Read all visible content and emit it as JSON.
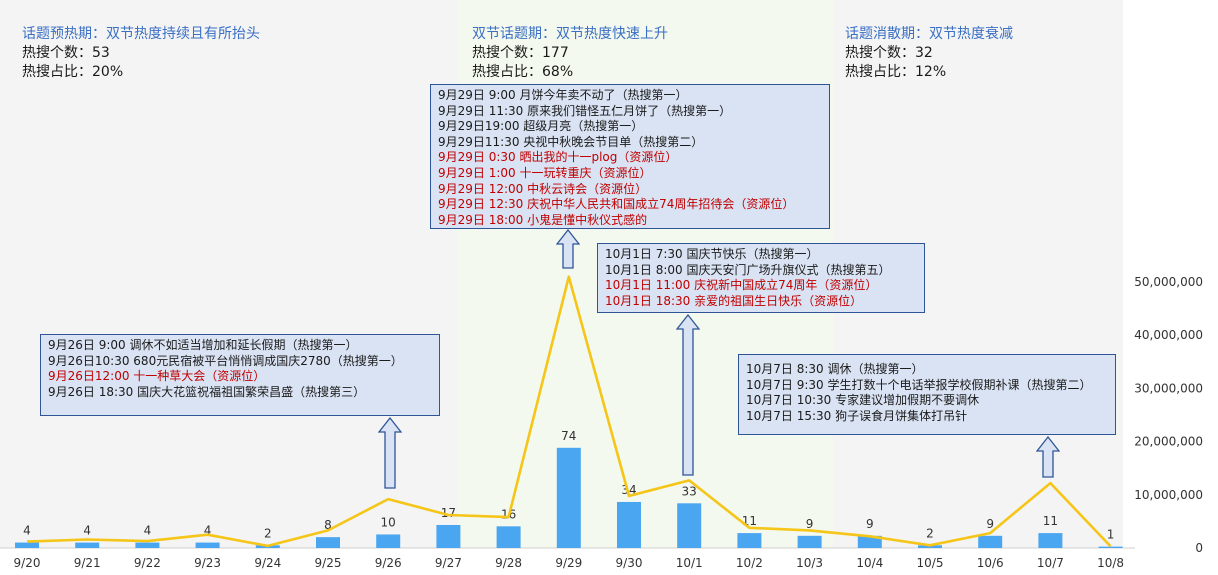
{
  "colors": {
    "bar": "#4aa6f0",
    "line": "#f5c518",
    "phase_pre_bg": "#f4f4f4",
    "phase_peak_bg": "#f3f9ee",
    "phase_post_bg": "#f4f4f4",
    "callout_bg": "#dae3f3",
    "callout_border": "#2f5597",
    "phase_title": "#3a6fc4",
    "red_text": "#c00000"
  },
  "phases": [
    {
      "title": "话题预热期：双节热度持续且有所抬头",
      "count": "热搜个数：53",
      "share": "热搜占比：20%"
    },
    {
      "title": "双节话题期：双节热度快速上升",
      "count": "热搜个数：177",
      "share": "热搜占比：68%"
    },
    {
      "title": "话题消散期：双节热度衰减",
      "count": "热搜个数：32",
      "share": "热搜占比：12%"
    }
  ],
  "callouts": [
    {
      "lines": [
        {
          "text": "9月26日 9:00 调休不如适当增加和延长假期（热搜第一）",
          "red": false
        },
        {
          "text": "9月26日10:30 680元民宿被平台悄悄调成国庆2780（热搜第一）",
          "red": false
        },
        {
          "text": "9月26日12:00 十一种草大会（资源位）",
          "red": true
        },
        {
          "text": "9月26日 18:30 国庆大花篮祝福祖国繁荣昌盛（热搜第三）",
          "red": false
        }
      ]
    },
    {
      "lines": [
        {
          "text": "9月29日 9:00  月饼今年卖不动了（热搜第一）",
          "red": false
        },
        {
          "text": "9月29日 11:30 原来我们错怪五仁月饼了（热搜第一）",
          "red": false
        },
        {
          "text": "9月29日19:00 超级月亮（热搜第一）",
          "red": false
        },
        {
          "text": "9月29日11:30 央视中秋晚会节目单（热搜第二）",
          "red": false
        },
        {
          "text": "9月29日 0:30 晒出我的十一plog（资源位）",
          "red": true
        },
        {
          "text": "9月29日 1:00 十一玩转重庆（资源位）",
          "red": true
        },
        {
          "text": "9月29日 12:00 中秋云诗会（资源位）",
          "red": true
        },
        {
          "text": "9月29日 12:30 庆祝中华人民共和国成立74周年招待会（资源位）",
          "red": true
        },
        {
          "text": "9月29日 18:00 小鬼是懂中秋仪式感的",
          "red": true
        }
      ]
    },
    {
      "lines": [
        {
          "text": "10月1日 7:30  国庆节快乐（热搜第一）",
          "red": false
        },
        {
          "text": "10月1日 8:00  国庆天安门广场升旗仪式（热搜第五）",
          "red": false
        },
        {
          "text": "10月1日 11:00 庆祝新中国成立74周年（资源位）",
          "red": true
        },
        {
          "text": "10月1日 18:30 亲爱的祖国生日快乐（资源位）",
          "red": true
        }
      ]
    },
    {
      "lines": [
        {
          "text": "10月7日 8:30 调休（热搜第一）",
          "red": false
        },
        {
          "text": "10月7日 9:30 学生打数十个电话举报学校假期补课（热搜第二）",
          "red": false
        },
        {
          "text": "10月7日 10:30 专家建议增加假期不要调休",
          "red": false
        },
        {
          "text": "10月7日 15:30 狗子误食月饼集体打吊针",
          "red": false
        }
      ]
    }
  ],
  "chart_data": {
    "type": "bar",
    "title": "",
    "xlabel": "",
    "ylabel": "",
    "categories": [
      "9/20",
      "9/21",
      "9/22",
      "9/23",
      "9/24",
      "9/25",
      "9/26",
      "9/27",
      "9/28",
      "9/29",
      "9/30",
      "10/1",
      "10/2",
      "10/3",
      "10/4",
      "10/5",
      "10/6",
      "10/7",
      "10/8"
    ],
    "series": [
      {
        "type": "bar",
        "axis": "left",
        "values": [
          4,
          4,
          4,
          4,
          2,
          8,
          10,
          17,
          16,
          74,
          34,
          33,
          11,
          9,
          9,
          2,
          9,
          11,
          1
        ]
      },
      {
        "type": "line",
        "axis": "right",
        "values": [
          1200000,
          1600000,
          1300000,
          2500000,
          400000,
          3300000,
          9200000,
          6200000,
          5800000,
          51000000,
          9800000,
          12700000,
          3800000,
          3300000,
          2200000,
          500000,
          2800000,
          12200000,
          300000
        ]
      }
    ],
    "ylim_left": [
      0,
      240
    ],
    "ylim_right": [
      0,
      50000000
    ],
    "yticks_right": [
      "0",
      "10,000,000",
      "20,000,000",
      "30,000,000",
      "40,000,000",
      "50,000,000"
    ],
    "grid": false,
    "legend": "none"
  }
}
